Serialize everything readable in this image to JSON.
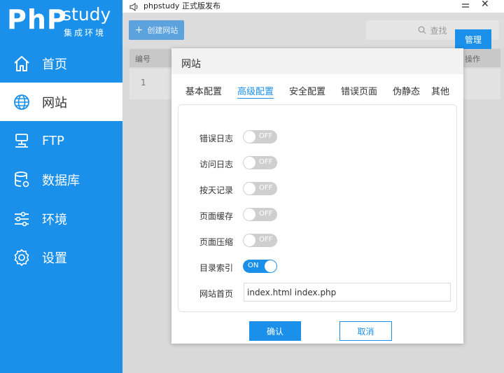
{
  "window": {
    "title": "phpstudy 正式版发布"
  },
  "logo": {
    "php": "PhP",
    "study": "study",
    "subtitle": "集成环境"
  },
  "sidebar": {
    "items": [
      {
        "label": "首页",
        "icon": "home-icon"
      },
      {
        "label": "网站",
        "icon": "globe-icon",
        "active": true
      },
      {
        "label": "FTP",
        "icon": "ftp-icon"
      },
      {
        "label": "数据库",
        "icon": "database-icon"
      },
      {
        "label": "环境",
        "icon": "sliders-icon"
      },
      {
        "label": "设置",
        "icon": "gear-icon"
      }
    ]
  },
  "toolbar": {
    "create_label": "创建网站",
    "search_placeholder": "查找"
  },
  "table": {
    "headers": {
      "id": "编号",
      "op": "操作"
    },
    "rows": [
      {
        "id": "1",
        "action": "管理"
      }
    ]
  },
  "modal": {
    "title": "网站",
    "tabs": [
      "基本配置",
      "高级配置",
      "安全配置",
      "错误页面",
      "伪静态",
      "其他"
    ],
    "active_tab": "高级配置",
    "settings": [
      {
        "label": "错误日志",
        "state": "OFF"
      },
      {
        "label": "访问日志",
        "state": "OFF"
      },
      {
        "label": "按天记录",
        "state": "OFF"
      },
      {
        "label": "页面缓存",
        "state": "OFF"
      },
      {
        "label": "页面压缩",
        "state": "OFF"
      },
      {
        "label": "目录索引",
        "state": "ON"
      }
    ],
    "homepage_label": "网站首页",
    "homepage_value": "index.html index.php",
    "confirm_label": "确认",
    "cancel_label": "取消"
  },
  "colors": {
    "accent": "#1a90ea",
    "toggle_off": "#cfcfcf"
  }
}
